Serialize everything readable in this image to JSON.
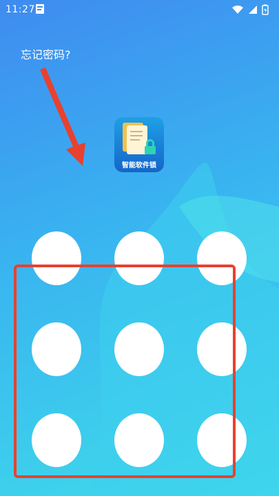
{
  "status_bar": {
    "time": "11:27",
    "icons": [
      "notification-icon",
      "wifi-icon",
      "signal-icon",
      "battery-icon"
    ]
  },
  "forgot_password": "忘记密码?",
  "app": {
    "name": "智能软件锁",
    "icon": "folder-lock-icon"
  },
  "pattern_lock": {
    "rows": 3,
    "cols": 3
  },
  "annotations": {
    "arrow_color": "#e8412f",
    "highlight_color": "#e8412f"
  },
  "colors": {
    "background_start": "#3f8bf0",
    "background_end": "#3fdcea",
    "dot": "#ffffff"
  }
}
